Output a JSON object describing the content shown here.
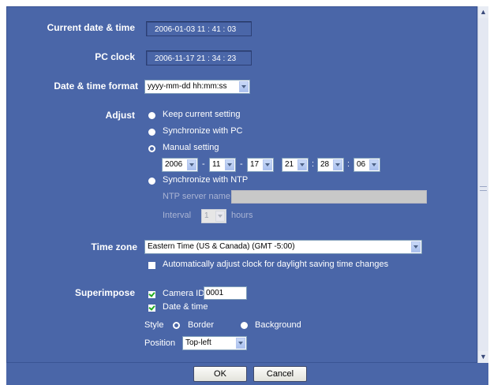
{
  "labels": {
    "current_datetime": "Current date & time",
    "pc_clock": "PC clock",
    "datetime_format": "Date & time format",
    "adjust": "Adjust",
    "time_zone": "Time zone",
    "superimpose": "Superimpose"
  },
  "current_datetime_value": "2006-01-03 11 : 41 : 03",
  "pc_clock_value": "2006-11-17 21 : 34 : 23",
  "datetime_format_selected": "yyyy-mm-dd hh:mm:ss",
  "adjust": {
    "options": [
      "Keep current setting",
      "Synchronize with PC",
      "Manual setting",
      "Synchronize with NTP"
    ],
    "selected": "Manual setting",
    "manual": {
      "year": "2006",
      "month": "11",
      "day": "17",
      "hour": "21",
      "minute": "28",
      "second": "06",
      "date_sep": "-",
      "time_sep": ":"
    },
    "ntp": {
      "server_label": "NTP server name",
      "server_value": "",
      "interval_label": "Interval",
      "interval_value": "1",
      "interval_unit": "hours"
    }
  },
  "time_zone": {
    "selected": "Eastern Time (US & Canada) (GMT -5:00)",
    "dst_label": "Automatically adjust clock for daylight saving time changes",
    "dst_checked": false
  },
  "superimpose": {
    "camera_id_label": "Camera ID",
    "camera_id_value": "0001",
    "camera_id_checked": true,
    "datetime_label": "Date & time",
    "datetime_checked": true,
    "style_label": "Style",
    "style_options": [
      "Border",
      "Background"
    ],
    "style_selected": "Border",
    "position_label": "Position",
    "position_selected": "Top-left"
  },
  "buttons": {
    "ok": "OK",
    "cancel": "Cancel"
  },
  "colors": {
    "panel_bg": "#4a66a8",
    "label_text": "#ffffff",
    "check_mark": "#22aa22"
  }
}
